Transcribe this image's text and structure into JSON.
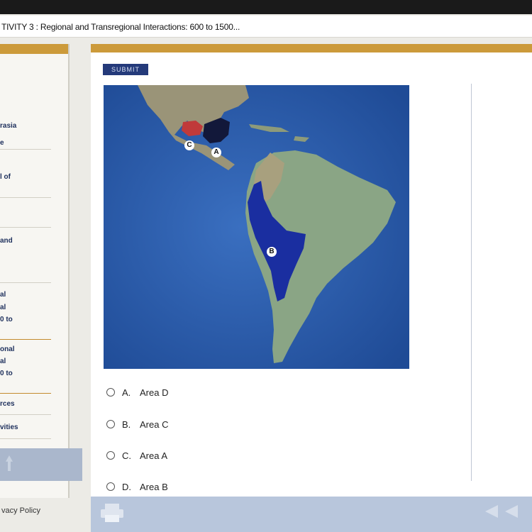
{
  "header": {
    "title": "TIVITY 3 : Regional and Transregional Interactions: 600 to 1500..."
  },
  "sidebar": {
    "items": [
      {
        "label": "rasia"
      },
      {
        "label": "e"
      },
      {
        "label": "l of"
      },
      {
        "label": "and"
      },
      {
        "label": "al"
      },
      {
        "label": "al"
      },
      {
        "label": "0 to"
      },
      {
        "label": "onal"
      },
      {
        "label": "al"
      },
      {
        "label": "0 to"
      },
      {
        "label": "rces"
      },
      {
        "label": "vities"
      }
    ],
    "privacy_link": "vacy Policy"
  },
  "main": {
    "submit_label": "SUBMIT",
    "map_labels": {
      "a": "A",
      "b": "B",
      "c": "C"
    },
    "choices": [
      {
        "letter": "A.",
        "text": "Area D"
      },
      {
        "letter": "B.",
        "text": "Area C"
      },
      {
        "letter": "C.",
        "text": "Area A"
      },
      {
        "letter": "D.",
        "text": "Area B"
      }
    ]
  },
  "colors": {
    "accent": "#cc9a3a",
    "submit": "#243a7a",
    "ocean": "#2a5aa8",
    "land": "#8aa585",
    "highlight_b": "#1a2ea0",
    "highlight_c": "#c03a3a"
  }
}
